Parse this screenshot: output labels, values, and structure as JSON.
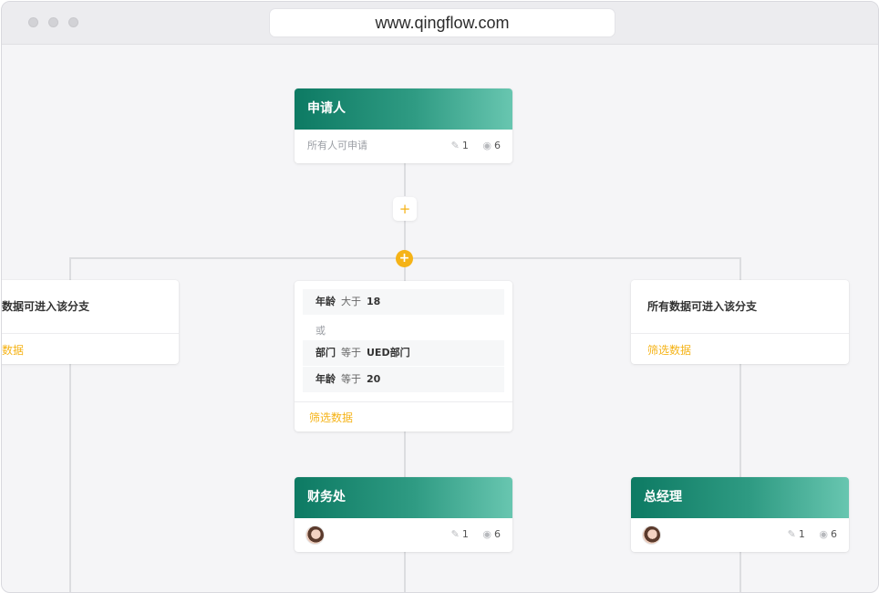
{
  "browser": {
    "url": "www.qingflow.com"
  },
  "start_node": {
    "title": "申请人",
    "subtitle": "所有人可申请",
    "edit_count": "1",
    "view_count": "6"
  },
  "add_button": {
    "label": "+"
  },
  "branch_add_button": {
    "label": "+"
  },
  "branches": {
    "left": {
      "title": "数据可进入该分支",
      "filter_label": "数据"
    },
    "middle": {
      "conditions": [
        {
          "field": "年龄",
          "op": "大于",
          "value": "18"
        },
        {
          "field": "部门",
          "op": "等于",
          "value": "UED部门"
        },
        {
          "field": "年龄",
          "op": "等于",
          "value": "20"
        }
      ],
      "or_label": "或",
      "filter_label": "筛选数据"
    },
    "right": {
      "title": "所有数据可进入该分支",
      "filter_label": "筛选数据"
    }
  },
  "approval_nodes": {
    "finance": {
      "title": "财务处",
      "edit_count": "1",
      "view_count": "6"
    },
    "manager": {
      "title": "总经理",
      "edit_count": "1",
      "view_count": "6"
    }
  },
  "colors": {
    "accent": "#f5b317",
    "header_start": "#0d7a63",
    "header_end": "#68c6b0"
  }
}
